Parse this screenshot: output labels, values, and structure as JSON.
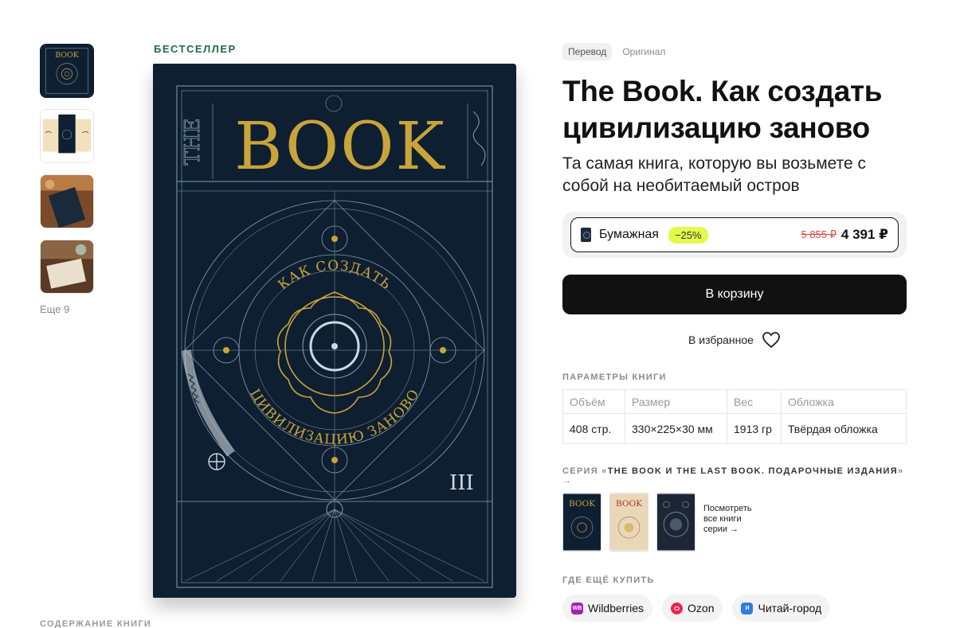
{
  "gallery": {
    "more_label": "Еще 9"
  },
  "product": {
    "bestseller_label": "БЕСТСЕЛЛЕР",
    "toggle": [
      "Перевод",
      "Оригинал"
    ],
    "title": "The Book. Как создать цивилизацию заново",
    "subtitle": "Та самая книга, которую вы возьмете с собой на необитаемый остров"
  },
  "cover": {
    "the": "THE",
    "book": "BOOK",
    "line1": "КАК СОЗДАТЬ",
    "line2": "ЦИВИЛИЗАЦИЮ ЗАНОВО"
  },
  "format": {
    "label": "Бумажная",
    "discount": "−25%",
    "old_price": "5 855 ₽",
    "price": "4 391 ₽"
  },
  "cart": {
    "label": "В корзину"
  },
  "favorite": {
    "label": "В избранное"
  },
  "params": {
    "heading": "ПАРАМЕТРЫ КНИГИ",
    "headers": [
      "Объём",
      "Размер",
      "Вес",
      "Обложка"
    ],
    "values": [
      "408 стр.",
      "330×225×30 мм",
      "1913 гр",
      "Твёрдая обложка"
    ]
  },
  "series": {
    "prefix": "СЕРИЯ «",
    "name": "THE BOOK И THE LAST BOOK. ПОДАРОЧНЫЕ ИЗДАНИЯ",
    "suffix": "» →",
    "see_all": "Посмотреть все книги серии →"
  },
  "where": {
    "heading": "ГДЕ ЕЩЁ КУПИТЬ",
    "stores": [
      {
        "name": "Wildberries",
        "logo": "WB",
        "color": "#a322b3"
      },
      {
        "name": "Ozon",
        "logo": "",
        "color": "#f0224f"
      },
      {
        "name": "Читай-город",
        "logo": "И",
        "color": "#2f7de1"
      }
    ]
  },
  "contents_heading": "СОДЕРЖАНИЕ КНИГИ",
  "colors": {
    "accent_green": "#1f6b43",
    "cover_navy": "#0e1f31",
    "cover_gold": "#c9a43a",
    "discount_highlight": "#e4f94b",
    "old_price_red": "#e04a3f"
  }
}
